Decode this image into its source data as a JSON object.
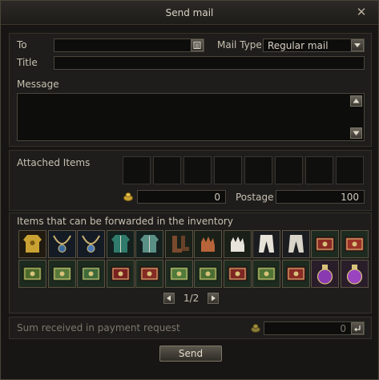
{
  "window": {
    "title": "Send mail"
  },
  "form": {
    "to_label": "To",
    "to_value": "",
    "mail_type_label": "Mail Type",
    "mail_type_value": "Regular mail",
    "title_label": "Title",
    "title_value": "",
    "message_label": "Message",
    "message_value": ""
  },
  "attached": {
    "label": "Attached Items",
    "slot_count": 8,
    "adena_value": "0",
    "postage_label": "Postage",
    "postage_value": "100"
  },
  "inventory": {
    "label": "Items that can be forwarded in the inventory",
    "row1": [
      {
        "icon": "gold-armor-icon",
        "color": "#c9a233"
      },
      {
        "icon": "necklace-icon",
        "color": "#3b6aa0"
      },
      {
        "icon": "necklace-icon",
        "color": "#4d7ab8"
      },
      {
        "icon": "robe-icon",
        "color": "#2f7a6a"
      },
      {
        "icon": "robe-icon",
        "color": "#5a8f86"
      },
      {
        "icon": "boots-icon",
        "color": "#7a4a2e"
      },
      {
        "icon": "gloves-icon",
        "color": "#b8643a"
      },
      {
        "icon": "gloves-icon",
        "color": "#e8e4dc"
      },
      {
        "icon": "pants-icon",
        "color": "#e6e2d8"
      },
      {
        "icon": "pants-icon",
        "color": "#d9d4c8"
      },
      {
        "icon": "red-book-icon",
        "color": "#8a2a22"
      },
      {
        "icon": "red-book-icon",
        "color": "#9a3226"
      }
    ],
    "row2": [
      {
        "icon": "green-book-icon",
        "color": "#4a6a2a"
      },
      {
        "icon": "green-book-icon",
        "color": "#56793a"
      },
      {
        "icon": "green-book-icon",
        "color": "#3d6a3a"
      },
      {
        "icon": "red-book-icon",
        "color": "#7a2020"
      },
      {
        "icon": "red-book-icon",
        "color": "#852a24"
      },
      {
        "icon": "green-book-icon",
        "color": "#4e7a3a"
      },
      {
        "icon": "green-book-icon",
        "color": "#4a6e32"
      },
      {
        "icon": "red-book-icon",
        "color": "#7e2622"
      },
      {
        "icon": "green-book-icon",
        "color": "#4f7434"
      },
      {
        "icon": "red-book-icon",
        "color": "#8a2a24"
      },
      {
        "icon": "purple-potion-icon",
        "color": "#8a3ab0"
      },
      {
        "icon": "purple-potion-icon",
        "color": "#9a44c0"
      }
    ],
    "page": "1/2"
  },
  "payment": {
    "label": "Sum received in payment request",
    "value": "0"
  },
  "send_label": "Send",
  "colors": {
    "border": "#4a4438",
    "panel": "#1e1d1b",
    "text": "#c7c0b1"
  }
}
